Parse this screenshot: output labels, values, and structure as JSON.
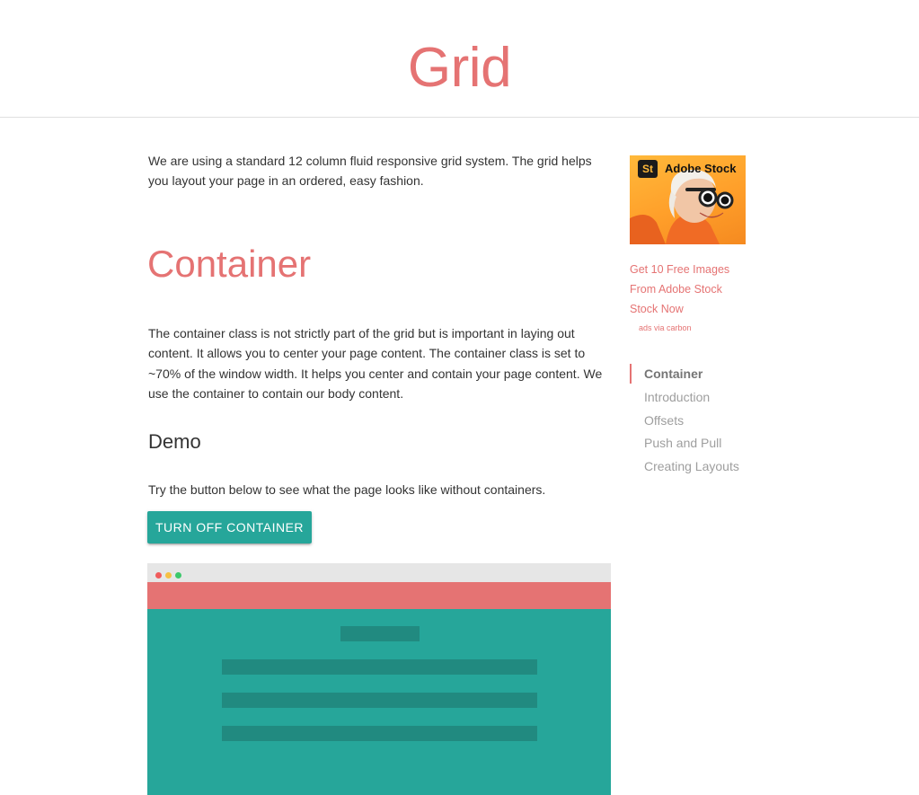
{
  "header": {
    "title": "Grid"
  },
  "intro": {
    "text": "We are using a standard 12 column fluid responsive grid system. The grid helps you layout your page in an ordered, easy fashion."
  },
  "container_section": {
    "title": "Container",
    "text": "The container class is not strictly part of the grid but is important in laying out content. It allows you to center your page content. The container class is set to ~70% of the window width. It helps you center and contain your page content. We use the container to contain our body content."
  },
  "demo": {
    "title": "Demo",
    "text": "Try the button below to see what the page looks like without containers.",
    "button_label": "Turn off Container"
  },
  "ad": {
    "logo_text": "St",
    "brand": "Adobe Stock",
    "link_text": "Get 10 Free Images From Adobe Stock Stock Now",
    "via": "ads via carbon"
  },
  "toc": {
    "items": [
      {
        "label": "Container",
        "active": true
      },
      {
        "label": "Introduction"
      },
      {
        "label": "Offsets"
      },
      {
        "label": "Push and Pull"
      },
      {
        "label": "Creating Layouts"
      }
    ]
  },
  "colors": {
    "accent": "#e57373",
    "teal": "#26a69a",
    "teal_dark": "#218a80"
  }
}
